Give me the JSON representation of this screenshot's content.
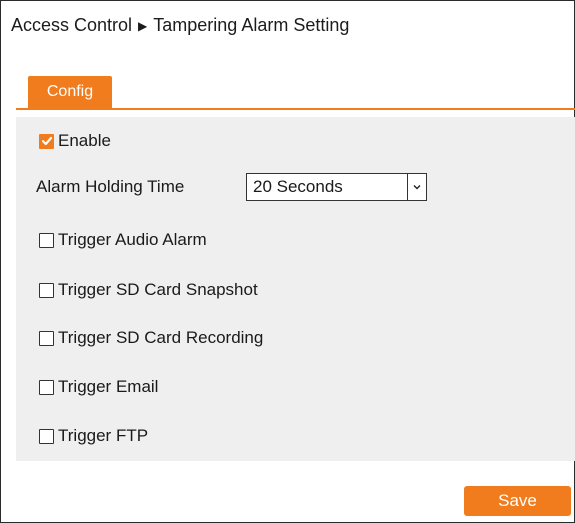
{
  "header": {
    "breadcrumb_root": "Access Control",
    "breadcrumb_separator": "▶",
    "breadcrumb_current": "Tampering Alarm Setting"
  },
  "tabs": [
    {
      "label": "Config",
      "active": true
    }
  ],
  "form": {
    "enable": {
      "label": "Enable",
      "checked": true
    },
    "alarm_holding_time": {
      "label": "Alarm Holding Time",
      "value": "20 Seconds"
    },
    "triggers": [
      {
        "label": "Trigger Audio Alarm",
        "checked": false
      },
      {
        "label": "Trigger SD Card Snapshot",
        "checked": false
      },
      {
        "label": "Trigger SD Card Recording",
        "checked": false
      },
      {
        "label": "Trigger Email",
        "checked": false
      },
      {
        "label": "Trigger FTP",
        "checked": false
      }
    ]
  },
  "actions": {
    "save_label": "Save"
  },
  "colors": {
    "accent": "#f07c1e",
    "panel_bg": "#efefef"
  },
  "icons": {
    "checkmark": "check-icon",
    "dropdown": "chevron-down-icon",
    "separator": "triangle-right-icon"
  }
}
